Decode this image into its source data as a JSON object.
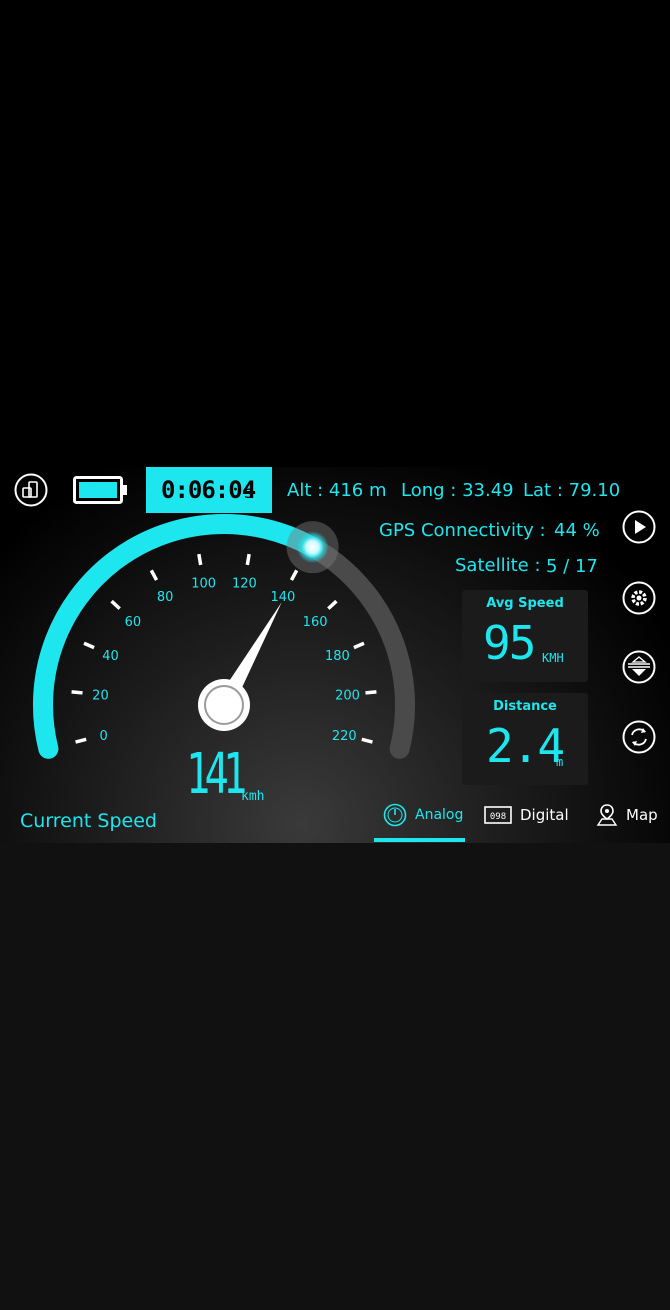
{
  "header": {
    "timer": "0:06:04",
    "timer_unit": "s",
    "altitude": "Alt : 416 m",
    "longitude": "Long : 33.49",
    "latitude": "Lat : 79.10"
  },
  "info": {
    "gps_label": "GPS Connectivity :",
    "gps_value": "44 %",
    "satellite_label": "Satellite :",
    "satellite_value": "5 / 17"
  },
  "avg_speed": {
    "label": "Avg Speed",
    "value": "95",
    "unit": "KMH"
  },
  "distance": {
    "label": "Distance",
    "value": "2.4",
    "unit": "m"
  },
  "gauge": {
    "ticks": [
      "0",
      "20",
      "40",
      "60",
      "80",
      "100",
      "120",
      "140",
      "160",
      "180",
      "200",
      "220"
    ],
    "current_speed": 141,
    "max_speed": 220,
    "readout": "141",
    "unit": "kmh"
  },
  "current_speed_label": "Current Speed",
  "tabs": [
    {
      "label": "Analog",
      "active": true,
      "icon": "speedometer-icon"
    },
    {
      "label": "Digital",
      "active": false,
      "icon": "digital-display-icon"
    },
    {
      "label": "Map",
      "active": false,
      "icon": "map-pin-icon"
    }
  ],
  "side_buttons": [
    "play-icon",
    "gear-icon",
    "hud-icon",
    "refresh-icon"
  ],
  "colors": {
    "accent": "#1ee6ee",
    "background": "#000000",
    "track": "#4a4a4a"
  }
}
